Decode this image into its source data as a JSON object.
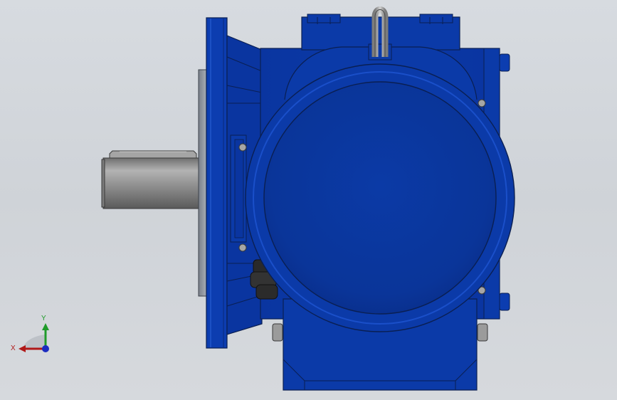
{
  "viewport": {
    "background_top": "#d7dbe0",
    "background_bottom": "#d6d9dd"
  },
  "model": {
    "body_color": "#0b3aa8",
    "body_dark": "#072a85",
    "body_light": "#1c56d4",
    "edge_color": "#0a1f52",
    "shaft_color": "#8e8e8e",
    "flange_face_color": "#9da3ab"
  },
  "triad": {
    "x_label": "X",
    "y_label": "Y",
    "x_color": "#b01818",
    "y_color": "#1f9b2a",
    "z_color": "#1b2cc0"
  }
}
